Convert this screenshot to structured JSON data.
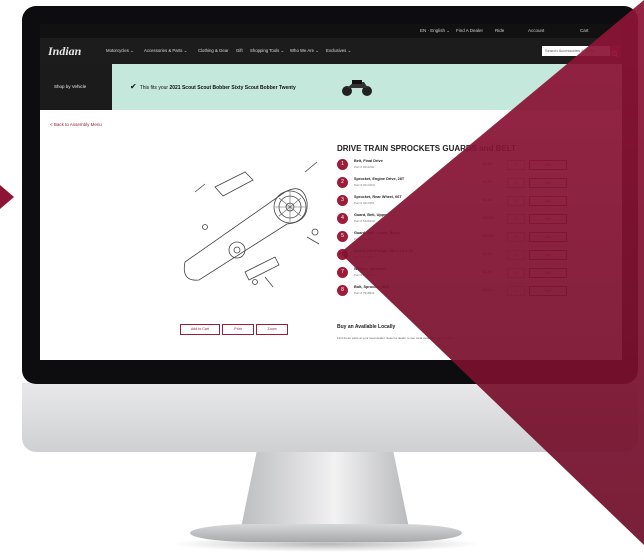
{
  "topbar": {
    "utilities": [
      "EN · English ⌄",
      "Find A Dealer",
      "Ride",
      "Account",
      "Cart"
    ]
  },
  "nav": {
    "logo_text": "Indian",
    "items": [
      "Motorcycles ⌄",
      "Accessories & Parts ⌄",
      "Clothing & Gear",
      "Gift",
      "Shopping Tools ⌄",
      "Who We Are ⌄",
      "Exclusives ⌄"
    ],
    "search_placeholder": "Search Accessories & Parts"
  },
  "banner": {
    "shop_by_vehicle": "Shop by Vehicle",
    "fit_prefix": "This fits your",
    "fit_vehicle": "2021 Scout Scout Bobber Sixty Scout Bobber Twenty"
  },
  "back_link": "< Back to Assembly Menu",
  "diagram_buttons": [
    "Add to Cart",
    "Print",
    "Zoom"
  ],
  "parts_title": "DRIVE TRAIN SPROCKETS GUARDS and BELT",
  "parts": [
    {
      "num": "1",
      "name": "Belt, Final Drive",
      "sku": "Part # 3211200",
      "price": "$1.99",
      "qty": "1",
      "add": "Add"
    },
    {
      "num": "2",
      "name": "Sprocket, Engine Drive, 28T",
      "sku": "Part # 3213160",
      "price": "$1.99",
      "qty": "1",
      "add": "Add"
    },
    {
      "num": "3",
      "name": "Sprocket, Rear Wheel, 66T",
      "sku": "Part # 3213151",
      "price": "$1.99",
      "qty": "1",
      "add": "Add"
    },
    {
      "num": "4",
      "name": "Guard, Belt, Upper",
      "sku": "Part # 5141640",
      "price": "$36.99",
      "qty": "1",
      "add": "Add"
    },
    {
      "num": "5",
      "name": "Guard, Belt, Lower, Black",
      "sku": "Part # 5141641",
      "price": "$24.99",
      "qty": "1",
      "add": "Add"
    },
    {
      "num": "6",
      "name": "Screw, Hex Flange, M6 x 1.0 x 16",
      "sku": "Part # 7519335",
      "price": "$2.99",
      "qty": "1",
      "add": "Add"
    },
    {
      "num": "7",
      "name": "Washer, Sprocket",
      "sku": "Part # 5137614",
      "price": "$1.99",
      "qty": "1",
      "add": "Add"
    },
    {
      "num": "8",
      "name": "Bolt, Sprocket, M10",
      "sku": "Part # 7518931",
      "price": "$3.99",
      "qty": "1",
      "add": "Add"
    }
  ],
  "local": {
    "title": "Buy an Available Locally",
    "text": "Find these parts at your local dealer. Select a dealer to see local availability and pricing."
  },
  "colors": {
    "brand_red": "#9b1d3a",
    "overlay_red": "#8e1436",
    "banner_green": "#c5e8dc",
    "nav_black": "#1c1c1c"
  }
}
